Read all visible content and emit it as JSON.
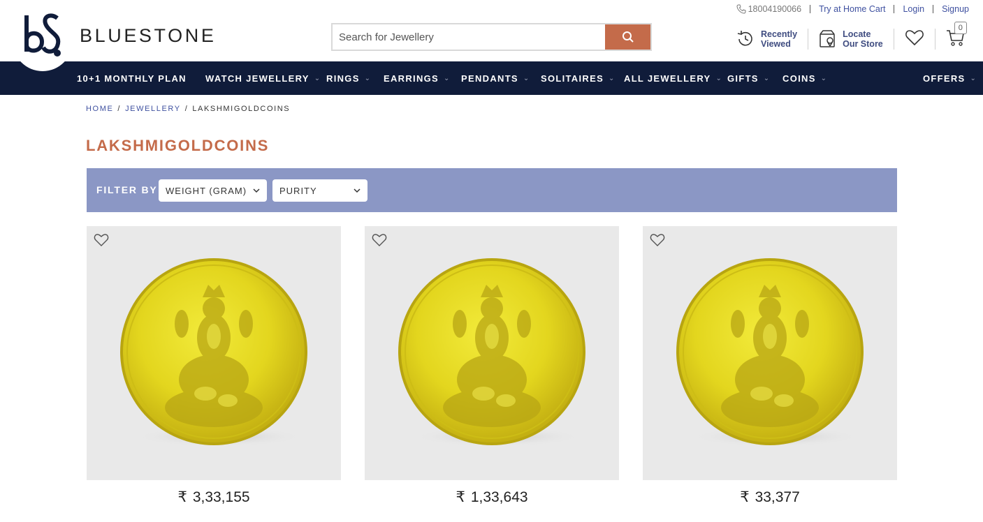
{
  "header": {
    "brand": "BLUESTONE",
    "search": {
      "placeholder": "Search for Jewellery"
    },
    "toplinks": {
      "phone": "18004190066",
      "try_home": "Try at Home Cart",
      "login": "Login",
      "signup": "Signup"
    },
    "utils": {
      "recent_line1": "Recently",
      "recent_line2": "Viewed",
      "locate_line1": "Locate",
      "locate_line2": "Our Store",
      "cart_count": "0"
    }
  },
  "nav": {
    "items": [
      {
        "label": "10+1 MONTHLY PLAN",
        "has_menu": false
      },
      {
        "label": "WATCH JEWELLERY",
        "has_menu": true
      },
      {
        "label": "RINGS",
        "has_menu": true
      },
      {
        "label": "EARRINGS",
        "has_menu": true
      },
      {
        "label": "PENDANTS",
        "has_menu": true
      },
      {
        "label": "SOLITAIRES",
        "has_menu": true
      },
      {
        "label": "ALL JEWELLERY",
        "has_menu": true
      },
      {
        "label": "GIFTS",
        "has_menu": true
      },
      {
        "label": "COINS",
        "has_menu": true
      },
      {
        "label": "OFFERS",
        "has_menu": true
      }
    ]
  },
  "breadcrumb": {
    "home": "HOME",
    "jewellery": "JEWELLERY",
    "current": "LAKSHMIGOLDCOINS",
    "sep": "/"
  },
  "page_title": "LAKSHMIGOLDCOINS",
  "filters": {
    "label": "FILTER BY",
    "weight": "WEIGHT (GRAM)",
    "purity": "PURITY"
  },
  "products": [
    {
      "price": "3,33,155",
      "currency": "₹"
    },
    {
      "price": "1,33,643",
      "currency": "₹"
    },
    {
      "price": "33,377",
      "currency": "₹"
    }
  ],
  "colors": {
    "accent": "#c46b4a",
    "nav_bg": "#101c3a",
    "filter_bg": "#8b97c5",
    "link": "#3f51a0"
  }
}
